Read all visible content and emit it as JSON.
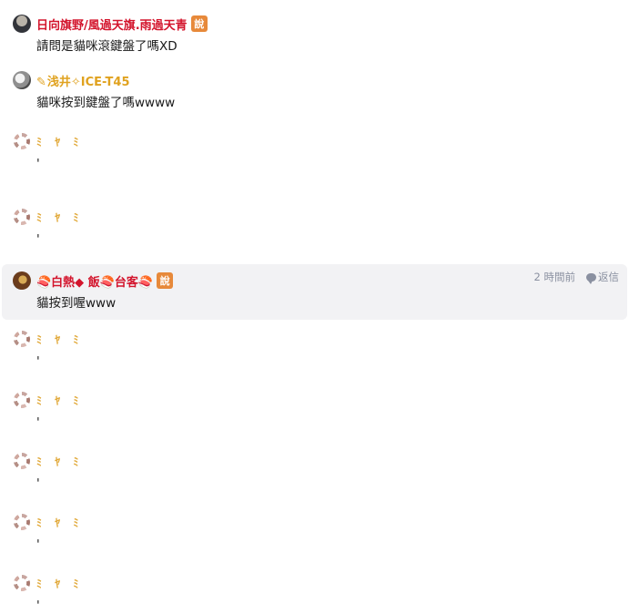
{
  "comments": [
    {
      "author": "日向旗野/風過天旗.雨過天青",
      "author_style": "red",
      "avatar": "dark",
      "badge": "說",
      "text": "請問是貓咪滾鍵盤了嗎XD",
      "highlight": false
    },
    {
      "author": "浅井✧ICE-T45",
      "author_style": "gold",
      "author_prefix_icon": "✎",
      "avatar": "grey",
      "text": "貓咪按到鍵盤了嗎wwww",
      "highlight": false
    },
    {
      "author": "ﾐ ﾔ ﾐ",
      "author_style": "faded",
      "avatar": "ring",
      "text": "'",
      "highlight": false
    },
    {
      "author": "ﾐ ﾔ ﾐ",
      "author_style": "faded",
      "avatar": "ring",
      "text": "'",
      "highlight": false
    },
    {
      "author": "🍣白熱◆ 飯🍣台客🍣",
      "author_style": "red",
      "avatar": "brown",
      "badge": "說",
      "text": "貓按到喔www",
      "highlight": true,
      "time": "2 時間前",
      "reply_label": "返信"
    },
    {
      "author": "ﾐ ﾔ ﾐ",
      "author_style": "faded",
      "avatar": "ring",
      "text": "'",
      "highlight": false
    },
    {
      "author": "ﾐ ﾔ ﾐ",
      "author_style": "faded",
      "avatar": "ring",
      "text": "'",
      "highlight": false
    },
    {
      "author": "ﾐ ﾔ ﾐ",
      "author_style": "faded",
      "avatar": "ring",
      "text": "'",
      "highlight": false
    },
    {
      "author": "ﾐ ﾔ ﾐ",
      "author_style": "faded",
      "avatar": "ring",
      "text": "'",
      "highlight": false
    },
    {
      "author": "ﾐ ﾔ ﾐ",
      "author_style": "faded",
      "avatar": "ring",
      "text": "'",
      "highlight": false
    }
  ]
}
